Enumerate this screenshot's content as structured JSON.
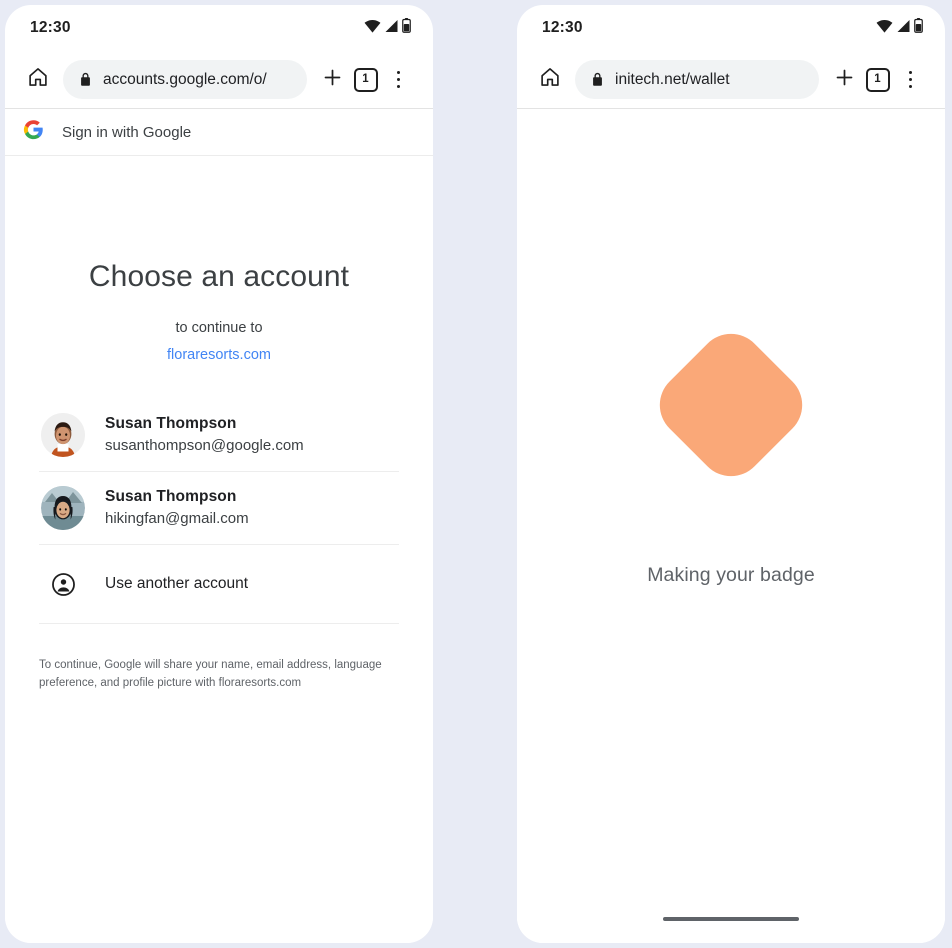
{
  "meta": {
    "background_color": "#e8ebf5",
    "panel_count": 2
  },
  "left_phone": {
    "status_bar": {
      "time": "12:30",
      "icons": [
        "wifi-icon",
        "cellular-signal-icon",
        "battery-icon"
      ]
    },
    "browser": {
      "home_icon": "home-icon",
      "lock_icon": "lock-icon",
      "url": "accounts.google.com/o/",
      "new_tab_icon": "plus-icon",
      "tab_count": "1",
      "menu_icon": "overflow-menu-icon"
    },
    "page": {
      "header": {
        "logo": "google-g-logo",
        "label": "Sign in with Google"
      },
      "title": "Choose an account",
      "subtitle": "to continue to",
      "domain": "floraresorts.com",
      "accounts": [
        {
          "name": "Susan Thompson",
          "email": "susanthompson@google.com",
          "avatar": "avatar-susan-google"
        },
        {
          "name": "Susan Thompson",
          "email": "hikingfan@gmail.com",
          "avatar": "avatar-susan-gmail"
        }
      ],
      "use_another_account": {
        "icon": "account-circle-icon",
        "label": "Use another account"
      },
      "consent_text": "To continue, Google will share your name, email address, language preference, and profile picture with floraresorts.com"
    }
  },
  "right_phone": {
    "status_bar": {
      "time": "12:30",
      "icons": [
        "wifi-icon",
        "cellular-signal-icon",
        "battery-icon"
      ]
    },
    "browser": {
      "home_icon": "home-icon",
      "lock_icon": "lock-icon",
      "url": "initech.net/wallet",
      "new_tab_icon": "plus-icon",
      "tab_count": "1",
      "menu_icon": "overflow-menu-icon"
    },
    "page": {
      "loader_shape": "rotated-rounded-square",
      "loader_color": "#faa878",
      "status_text": "Making your badge",
      "home_indicator": "home-indicator-bar"
    }
  }
}
